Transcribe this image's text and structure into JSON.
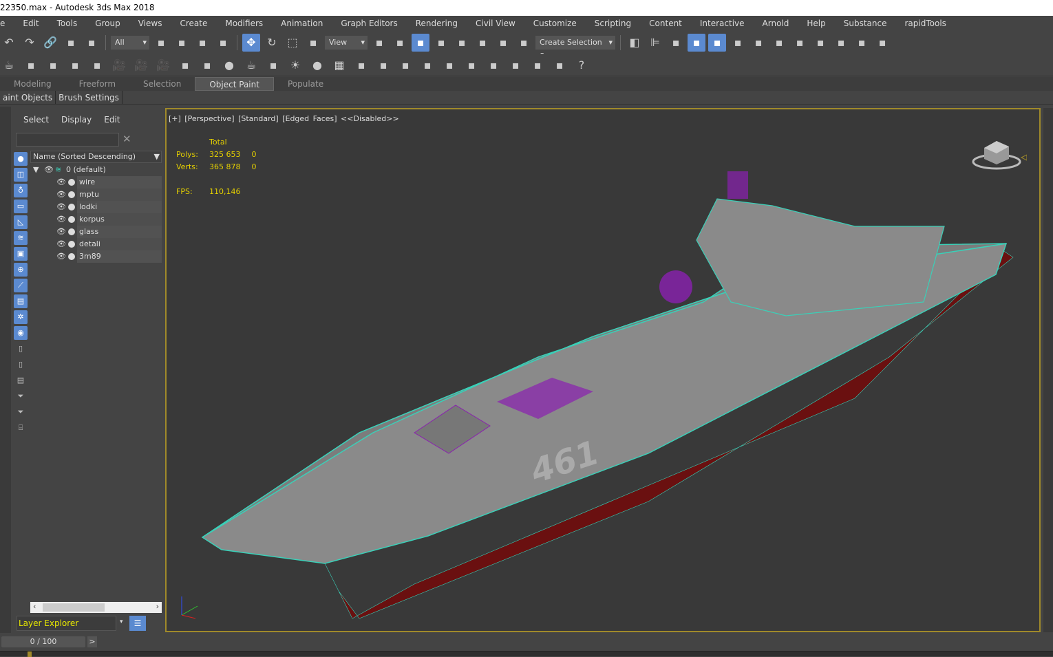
{
  "window": {
    "title": "22350.max - Autodesk 3ds Max 2018"
  },
  "menu": [
    "e",
    "Edit",
    "Tools",
    "Group",
    "Views",
    "Create",
    "Modifiers",
    "Animation",
    "Graph Editors",
    "Rendering",
    "Civil View",
    "Customize",
    "Scripting",
    "Content",
    "Interactive",
    "Arnold",
    "Help",
    "Substance",
    "rapidTools"
  ],
  "toolbar1": {
    "selection_filter": "All",
    "coordinate_system": "View",
    "named_selection": "Create Selection Se",
    "icons_a": [
      "undo-icon",
      "redo-icon",
      "link-icon",
      "unlink-icon",
      "bind-space-warp-icon"
    ],
    "icons_b": [
      "select-object-icon",
      "select-by-name-icon",
      "rectangle-selection-icon",
      "window-crossing-icon"
    ],
    "icons_c": [
      "move-icon",
      "rotate-icon",
      "scale-icon",
      "placement-icon"
    ],
    "icons_d": [
      "pivot-icon",
      "select-manipulate-icon",
      "keyboard-shortcut-icon",
      "snap-3d-icon",
      "angle-snap-icon",
      "percent-snap-icon",
      "spinner-snap-icon",
      "edit-named-selections-icon"
    ],
    "icons_e": [
      "mirror-icon",
      "align-icon",
      "toggle-scene-explorer-icon",
      "toggle-layer-explorer-icon",
      "toggle-ribbon-icon",
      "curve-editor-icon",
      "schematic-view-icon",
      "material-editor-icon",
      "render-setup-icon",
      "rendered-frame-window-icon",
      "render-production-icon",
      "render-cloud-icon",
      "render-shortcuts-icon"
    ]
  },
  "toolbar2": {
    "icons": [
      "teapot-icon",
      "render-icon",
      "panel-icon",
      "panel2-icon",
      "light-lister-icon",
      "camera-icon",
      "camera-sphere-icon",
      "camera-record-icon",
      "plane-light-icon",
      "dome-light-icon",
      "sphere-light-icon",
      "teapot-wire-icon",
      "cone-light-icon",
      "sun-icon",
      "sphere-icon",
      "grid-icon",
      "molecule-icon",
      "tripod-icon",
      "gear-particle-icon",
      "grass-icon",
      "hair-icon",
      "ball-icon",
      "globe-icon",
      "material-icon",
      "render-region-icon",
      "script-icon",
      "help-icon"
    ]
  },
  "ribbon": {
    "tabs": [
      "Modeling",
      "Freeform",
      "Selection",
      "Object Paint",
      "Populate"
    ],
    "active": "Object Paint",
    "subtabs": [
      "aint Objects",
      "Brush Settings"
    ]
  },
  "explorer": {
    "menu": [
      "Select",
      "Display",
      "Edit"
    ],
    "search_value": "",
    "column_header": "Name (Sorted Descending)",
    "root_layer": "0 (default)",
    "layers": [
      "wire",
      "mptu",
      "lodki",
      "korpus",
      "glass",
      "detali",
      "3m89"
    ],
    "explorer_type": "Layer Explorer"
  },
  "viewport": {
    "label": "[+] [Perspective] [Standard] [Edged Faces]  <<Disabled>>",
    "stats": {
      "total_label": "Total",
      "polys_label": "Polys:",
      "polys": "325 653",
      "polys_sel": "0",
      "verts_label": "Verts:",
      "verts": "365 878",
      "verts_sel": "0",
      "fps_label": "FPS:",
      "fps": "110,146"
    },
    "hull_number": "461",
    "colors": {
      "wire": "#3ad0b8",
      "hull": "#8a8a8a",
      "below_waterline": "#6a1010",
      "accent": "#8a20b0",
      "border": "#a08a2a"
    }
  },
  "timeslider": {
    "frame": "0 / 100",
    "next": ">"
  }
}
